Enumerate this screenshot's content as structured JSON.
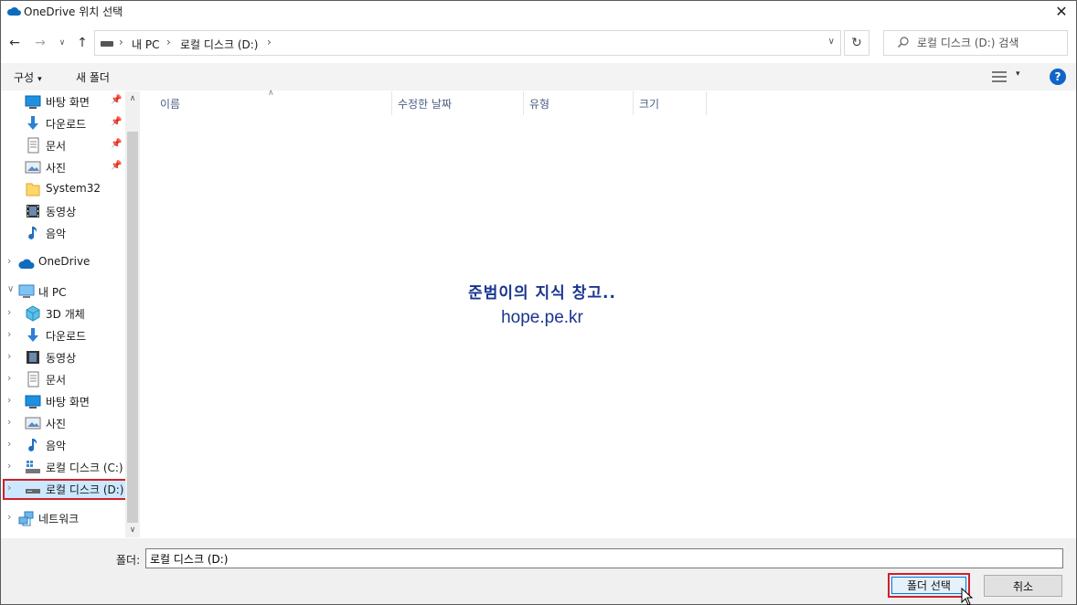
{
  "window": {
    "title": "OneDrive 위치 선택",
    "close_glyph": "✕"
  },
  "nav": {
    "back_glyph": "←",
    "forward_glyph": "→",
    "recent_glyph": "∨",
    "up_glyph": "↑",
    "breadcrumbs": [
      "내 PC",
      "로컬 디스크 (D:)"
    ],
    "crumb_sep": "›",
    "dropdown_glyph": "∨",
    "refresh_glyph": "↻",
    "search_placeholder": "로컬 디스크 (D:) 검색"
  },
  "toolbar": {
    "organize_label": "구성",
    "organize_caret": "▾",
    "new_folder_label": "새 폴더",
    "view_caret": "▾",
    "help_label": "?"
  },
  "sidebar": {
    "quick_access": [
      {
        "label": "바탕 화면",
        "icon": "desktop-icon",
        "pinned": true
      },
      {
        "label": "다운로드",
        "icon": "download-icon",
        "pinned": true
      },
      {
        "label": "문서",
        "icon": "document-icon",
        "pinned": true
      },
      {
        "label": "사진",
        "icon": "pictures-icon",
        "pinned": true
      },
      {
        "label": "System32",
        "icon": "folder-icon",
        "pinned": false
      },
      {
        "label": "동영상",
        "icon": "video-icon",
        "pinned": false
      },
      {
        "label": "음악",
        "icon": "music-icon",
        "pinned": false
      }
    ],
    "onedrive": "OneDrive",
    "this_pc": "내 PC",
    "pc_items": [
      {
        "label": "3D 개체",
        "icon": "3d-objects-icon"
      },
      {
        "label": "다운로드",
        "icon": "download-icon"
      },
      {
        "label": "동영상",
        "icon": "video-icon"
      },
      {
        "label": "문서",
        "icon": "document-icon"
      },
      {
        "label": "바탕 화면",
        "icon": "desktop-icon"
      },
      {
        "label": "사진",
        "icon": "pictures-icon"
      },
      {
        "label": "음악",
        "icon": "music-icon"
      },
      {
        "label": "로컬 디스크 (C:)",
        "icon": "drive-c-icon"
      },
      {
        "label": "로컬 디스크 (D:)",
        "icon": "drive-icon",
        "selected": true
      }
    ],
    "network": "네트워크",
    "pin_glyph": "📌",
    "chev_right": "›",
    "chev_down": "∨",
    "scroll_up": "∧",
    "scroll_down": "∨"
  },
  "columns": {
    "name": "이름",
    "modified": "수정한 날짜",
    "type": "유형",
    "size": "크기",
    "sort_glyph": "∧"
  },
  "watermark": {
    "line1": "준범이의 지식 창고..",
    "line2": "hope.pe.kr"
  },
  "footer": {
    "folder_label": "폴더:",
    "folder_value": "로컬 디스크 (D:)",
    "select_button": "폴더 선택",
    "cancel_button": "취소"
  },
  "colors": {
    "accent": "#0078d7",
    "highlight": "#d0202a",
    "selection": "#cce8ff",
    "onedrive": "#0f6cbd"
  }
}
